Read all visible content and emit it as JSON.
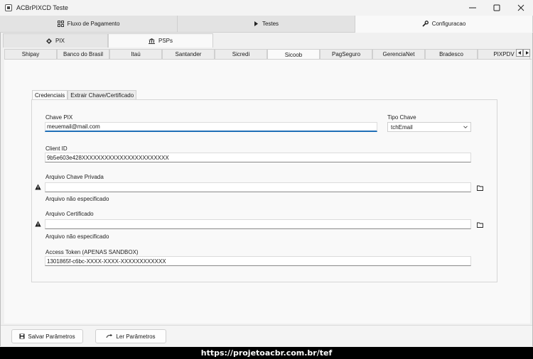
{
  "window": {
    "title": "ACBrPIXCD Teste"
  },
  "main_tabs": [
    {
      "label": "Fluxo de Pagamento",
      "icon": "flow-icon"
    },
    {
      "label": "Testes",
      "icon": "play-icon"
    },
    {
      "label": "Configuracao",
      "icon": "wrench-icon"
    }
  ],
  "sub_tabs": [
    {
      "label": "PIX",
      "icon": "pix-icon"
    },
    {
      "label": "PSPs",
      "icon": "bank-icon"
    }
  ],
  "psp_tabs": [
    "Shipay",
    "Banco do Brasil",
    "Itaú",
    "Santander",
    "Sicredi",
    "Sicoob",
    "PagSeguro",
    "GerenciaNet",
    "Bradesco",
    "PIXPDV"
  ],
  "inner_tabs": [
    "Credenciais",
    "Extrair Chave/Certificado"
  ],
  "form": {
    "chave_pix_label": "Chave PIX",
    "chave_pix_value": "meuemail@mail.com",
    "tipo_chave_label": "Tipo Chave",
    "tipo_chave_value": "tchEmail",
    "client_id_label": "Client ID",
    "client_id_value": "9b5e603e428XXXXXXXXXXXXXXXXXXXXXXX",
    "chave_privada_label": "Arquivo Chave Privada",
    "chave_privada_value": "",
    "chave_privada_status": "Arquivo não especificado",
    "certificado_label": "Arquivo Certificado",
    "certificado_value": "",
    "certificado_status": "Arquivo não especificado",
    "access_token_label": "Access Token (APENAS SANDBOX)",
    "access_token_value": "1301865f-c6bc-XXXX-XXXX-XXXXXXXXXXXX"
  },
  "buttons": {
    "salvar": "Salvar Parâmetros",
    "ler": "Ler Parâmetros"
  },
  "footer": {
    "url": "https://projetoacbr.com.br/tef"
  }
}
